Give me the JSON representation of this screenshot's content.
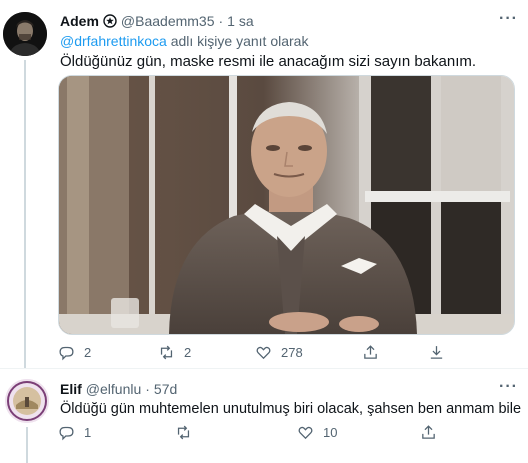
{
  "tweet1": {
    "author": "Adem",
    "handle": "@Baademm35",
    "separator": "·",
    "time": "1 sa",
    "reply_mention": "@drfahrettinkoca",
    "reply_suffix": "adlı kişiye yanıt olarak",
    "text": "Öldüğünüz gün, maske resmi ile anacağım sizi sayın bakanım.",
    "more": "···",
    "replies": "2",
    "retweets": "2",
    "likes": "278"
  },
  "tweet2": {
    "author": "Elif",
    "handle": "@elfunlu",
    "separator": "·",
    "time": "57d",
    "text": "Öldüğü gün muhtemelen unutulmuş biri olacak, şahsen ben anmam bile",
    "more": "···",
    "replies": "1",
    "retweets": "",
    "likes": "10"
  },
  "colors": {
    "accent": "#1d9bf0",
    "muted": "#536471"
  },
  "icons": [
    "reply-icon",
    "retweet-icon",
    "like-icon",
    "share-icon",
    "download-icon",
    "more-icon",
    "badge-icon"
  ]
}
